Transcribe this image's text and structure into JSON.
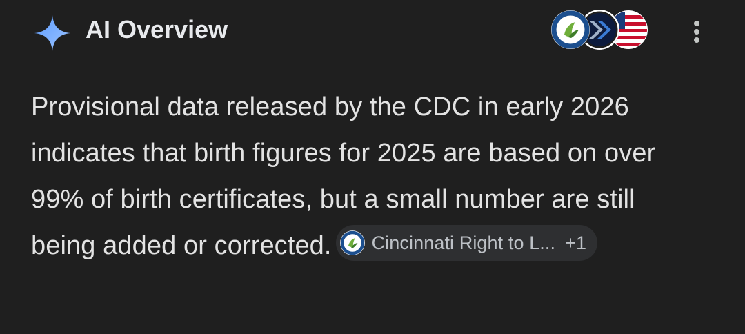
{
  "header": {
    "title": "AI Overview",
    "icon": "sparkle-icon",
    "accent": "#7eb3ff"
  },
  "sources": [
    {
      "icon": "cincinnati-right-to-life-logo-icon"
    },
    {
      "icon": "chevron-logo-icon"
    },
    {
      "icon": "us-flag-icon"
    }
  ],
  "menu": {
    "icon": "more-vert-icon"
  },
  "overview": {
    "text": "Provisional data released by the CDC in early 2026 indicates that birth figures for 2025 are based on over 99% of birth certificates, but a small number are still being added or corrected.",
    "citation": {
      "label": "Cincinnati Right to L...",
      "count": "+1",
      "icon": "cincinnati-right-to-life-logo-icon"
    }
  }
}
